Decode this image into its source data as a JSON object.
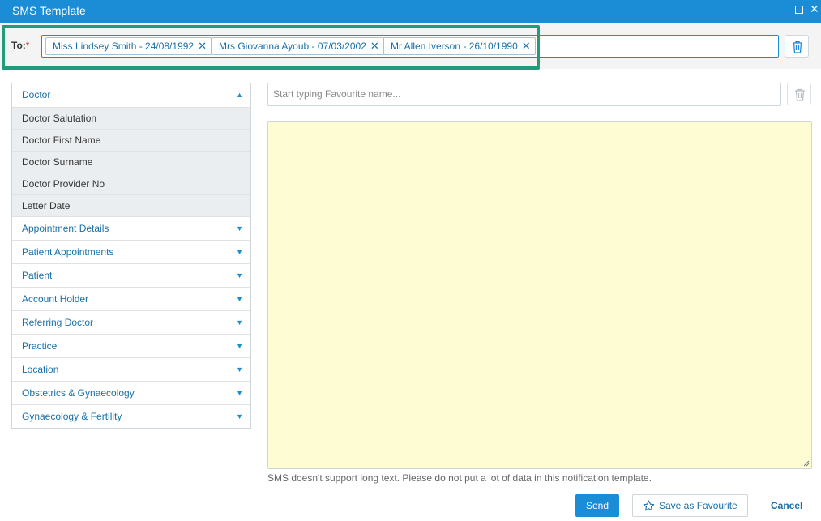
{
  "window": {
    "title": "SMS Template"
  },
  "to": {
    "label": "To:",
    "required_mark": "*",
    "recipients": [
      "Miss Lindsey Smith - 24/08/1992",
      "Mrs Giovanna Ayoub - 07/03/2002",
      "Mr Allen Iverson - 26/10/1990"
    ],
    "remove_glyph": "✕"
  },
  "fields": {
    "expanded_group": "Doctor",
    "expanded_items": [
      "Doctor Salutation",
      "Doctor First Name",
      "Doctor Surname",
      "Doctor Provider No",
      "Letter Date"
    ],
    "groups": [
      "Appointment Details",
      "Patient Appointments",
      "Patient",
      "Account Holder",
      "Referring Doctor",
      "Practice",
      "Location",
      "Obstetrics & Gynaecology",
      "Gynaecology & Fertility"
    ]
  },
  "favourite": {
    "placeholder": "Start typing Favourite name..."
  },
  "message": {
    "value": ""
  },
  "note": "SMS doesn't support long text. Please do not put a lot of data in this notification template.",
  "actions": {
    "send": "Send",
    "save_favourite": "Save as Favourite",
    "cancel": "Cancel"
  },
  "colors": {
    "accent": "#1a8dd6",
    "highlight": "#1e9c7b",
    "message_bg": "#fefcd3"
  }
}
